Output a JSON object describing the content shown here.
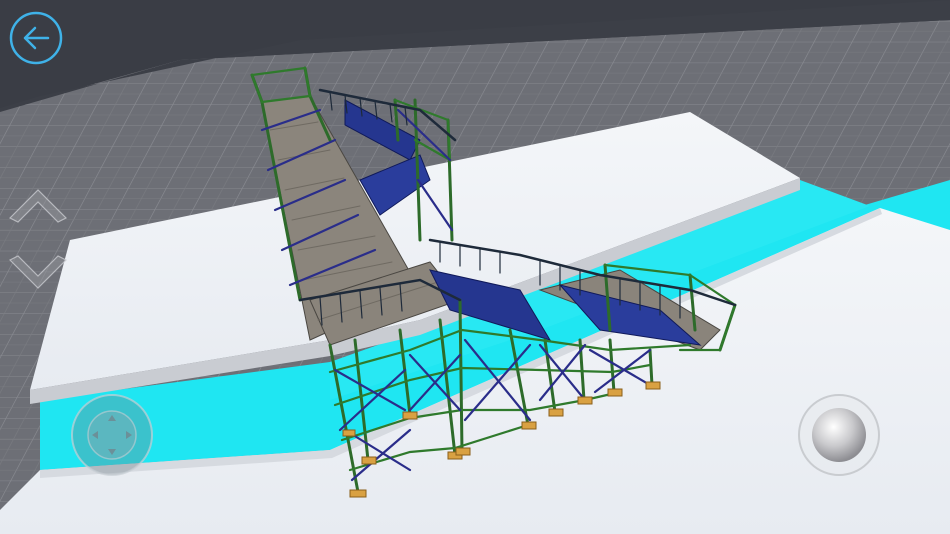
{
  "app": {
    "view": "scaffold-3d-viewer"
  },
  "hud": {
    "back_icon": "arrow-left-icon",
    "camera_up_icon": "chevron-up-icon",
    "camera_down_icon": "chevron-down-icon",
    "joystick_icon": "dpad-joystick-icon",
    "action_icon": "sphere-button-icon"
  },
  "colors": {
    "background": "#3b3e46",
    "grid_floor": "#6e7077",
    "grid_line": "#8a8c92",
    "platform": "#eef1f5",
    "water": "#1fe6f2",
    "frame_green": "#2d6b2a",
    "brace_blue": "#2a2d8a",
    "deck": "#8b857c",
    "stair_blue": "#25368f",
    "footplate": "#d9a142"
  }
}
